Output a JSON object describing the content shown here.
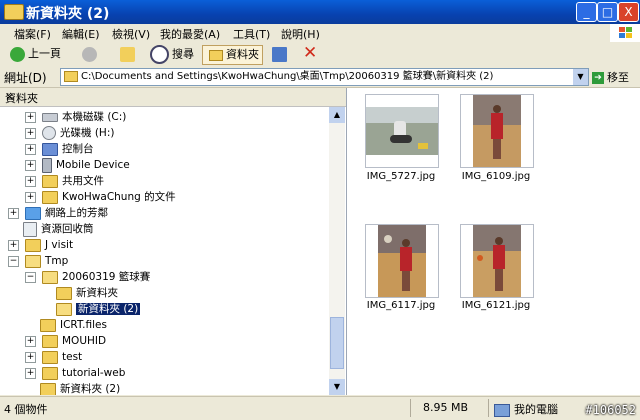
{
  "window": {
    "title": "新資料夾 (2)"
  },
  "window_controls": {
    "minimize": "_",
    "maximize": "□",
    "close": "X"
  },
  "menu": [
    "檔案(F)",
    "編輯(E)",
    "檢視(V)",
    "我的最愛(A)",
    "工具(T)",
    "說明(H)"
  ],
  "toolbar": {
    "back": "上一頁",
    "search": "搜尋",
    "folders": "資料夾"
  },
  "address": {
    "label": "網址(D)",
    "value": "C:\\Documents and Settings\\KwoHwaChung\\桌面\\Tmp\\20060319 籃球賽\\新資料夾 (2)",
    "go": "移至"
  },
  "folder_pane": {
    "title": "資料夾",
    "close": "×",
    "items": [
      {
        "label": "本機磁碟 (C:)",
        "expander": "+",
        "icon": "drive-icon"
      },
      {
        "label": "光碟機 (H:)",
        "expander": "+",
        "icon": "cd-icon"
      },
      {
        "label": "控制台",
        "expander": "+",
        "icon": "control-panel-icon"
      },
      {
        "label": "Mobile Device",
        "expander": "+",
        "icon": "device-icon"
      },
      {
        "label": "共用文件",
        "expander": "+",
        "icon": "folder-icon"
      },
      {
        "label": "KwoHwaChung 的文件",
        "expander": "+",
        "icon": "folder-icon"
      },
      {
        "label": "網路上的芳鄰",
        "expander": "+",
        "icon": "network-icon"
      },
      {
        "label": "資源回收筒",
        "expander": "",
        "icon": "recycle-bin-icon"
      },
      {
        "label": "J visit",
        "expander": "+",
        "icon": "folder-icon"
      },
      {
        "label": "Tmp",
        "expander": "−",
        "icon": "folder-icon"
      },
      {
        "label": "20060319 籃球賽",
        "expander": "−",
        "icon": "folder-icon"
      },
      {
        "label": "新資料夾",
        "expander": "",
        "icon": "folder-icon"
      },
      {
        "label": "新資料夾 (2)",
        "expander": "",
        "icon": "folder-open-icon"
      },
      {
        "label": "ICRT.files",
        "expander": "",
        "icon": "folder-icon"
      },
      {
        "label": "MOUHID",
        "expander": "+",
        "icon": "folder-icon"
      },
      {
        "label": "test",
        "expander": "+",
        "icon": "folder-icon"
      },
      {
        "label": "tutorial-web",
        "expander": "+",
        "icon": "folder-icon"
      },
      {
        "label": "新資料夾 (2)",
        "expander": "",
        "icon": "folder-icon"
      }
    ]
  },
  "files": [
    {
      "name": "IMG_5727.jpg"
    },
    {
      "name": "IMG_6109.jpg"
    },
    {
      "name": "IMG_6117.jpg"
    },
    {
      "name": "IMG_6121.jpg"
    }
  ],
  "status": {
    "count": "4 個物件",
    "size": "8.95 MB",
    "location": "我的電腦"
  },
  "watermark": "#106052",
  "colors": {
    "title_bar": "#0a5fd8",
    "selection": "#0a246a"
  }
}
